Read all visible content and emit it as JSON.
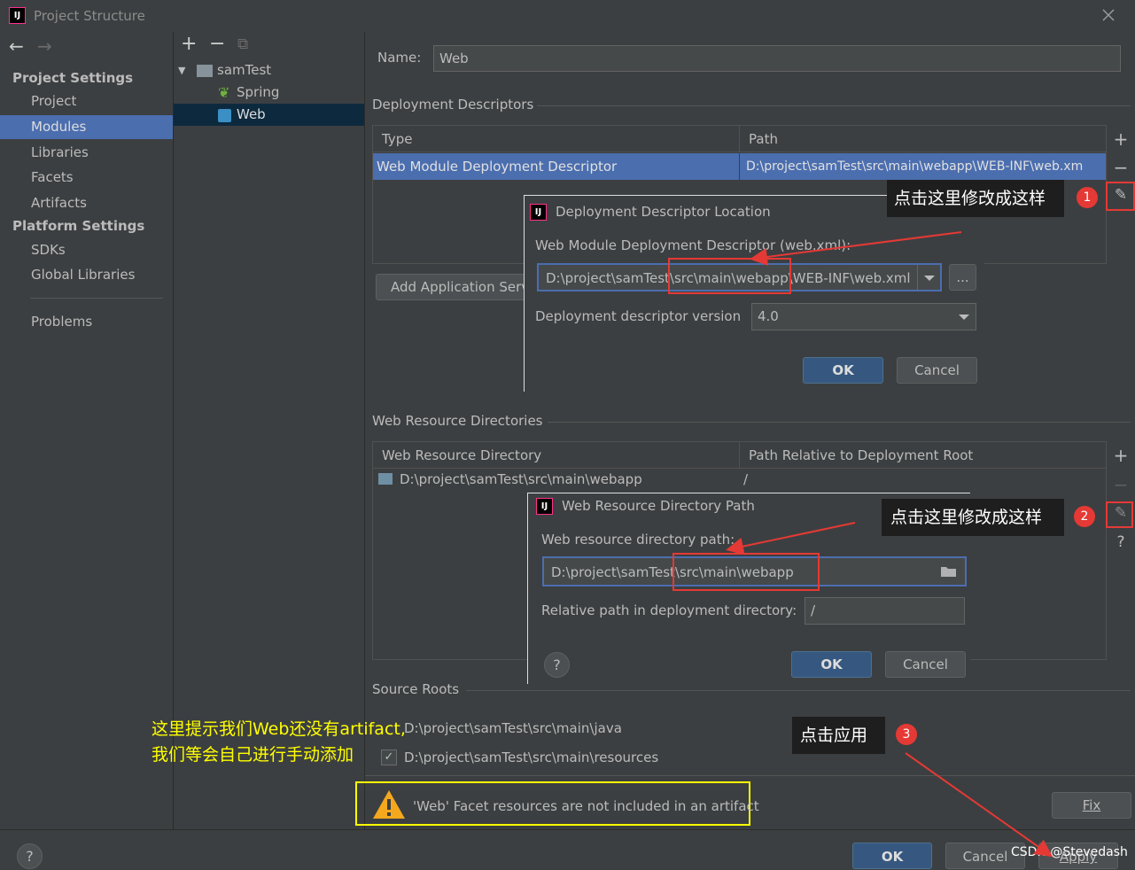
{
  "window": {
    "title": "Project Structure",
    "app_icon": "IJ"
  },
  "toolbar_left": {
    "back": "←",
    "forward": "→"
  },
  "toolbar_tree": {
    "add": "+",
    "remove": "−",
    "copy": "⧉"
  },
  "nav": {
    "project_settings": "Project Settings",
    "items_ps": [
      "Project",
      "Modules",
      "Libraries",
      "Facets",
      "Artifacts"
    ],
    "platform_settings": "Platform Settings",
    "items_plat": [
      "SDKs",
      "Global Libraries"
    ],
    "problems": "Problems",
    "selected": "Modules"
  },
  "tree": {
    "root": "samTest",
    "children": [
      "Spring",
      "Web"
    ],
    "selected": "Web"
  },
  "name": {
    "label": "Name:",
    "value": "Web"
  },
  "deployment": {
    "title": "Deployment Descriptors",
    "col_type": "Type",
    "col_path": "Path",
    "row_type": "Web Module Deployment Descriptor",
    "row_path": "D:\\project\\samTest\\src\\main\\webapp\\WEB-INF\\web.xm",
    "add_app_server": "Add Application Server specific descriptor..."
  },
  "dialog1": {
    "title": "Deployment Descriptor Location",
    "label": "Web Module Deployment Descriptor (web.xml):",
    "path": "D:\\project\\samTest\\src\\main\\webapp\\WEB-INF\\web.xml",
    "browse": "...",
    "version_label": "Deployment descriptor version",
    "version": "4.0",
    "ok": "OK",
    "cancel": "Cancel"
  },
  "web_resources": {
    "title": "Web Resource Directories",
    "col_dir": "Web Resource Directory",
    "col_rel": "Path Relative to Deployment Root",
    "row_dir": "D:\\project\\samTest\\src\\main\\webapp",
    "row_rel": "/"
  },
  "dialog2": {
    "title": "Web Resource Directory Path",
    "label": "Web resource directory path:",
    "path": "D:\\project\\samTest\\src\\main\\webapp",
    "rel_label": "Relative path in deployment directory:",
    "rel_value": "/",
    "help": "?",
    "ok": "OK",
    "cancel": "Cancel"
  },
  "source_roots": {
    "title": "Source Roots",
    "items": [
      "D:\\project\\samTest\\src\\main\\java",
      "D:\\project\\samTest\\src\\main\\resources"
    ]
  },
  "warning": {
    "text": "'Web' Facet resources are not included in an artifact",
    "fix": "Fix"
  },
  "bottom": {
    "help": "?",
    "ok": "OK",
    "cancel": "Cancel",
    "apply": "Apply"
  },
  "annotations": {
    "callout1": "点击这里修改成这样",
    "callout2": "点击这里修改成这样",
    "callout3": "点击应用",
    "num1": "1",
    "num2": "2",
    "num3": "3",
    "note_line1": "这里提示我们Web还没有artifact,",
    "note_line2": "我们等会自己进行手动添加",
    "watermark": "CSDN @Stevedash"
  },
  "colors": {
    "selection": "#4b6eaf",
    "default_button": "#365880",
    "annotation_red": "#e53935",
    "note_yellow": "#ffff00",
    "warning": "#f4a81d"
  }
}
